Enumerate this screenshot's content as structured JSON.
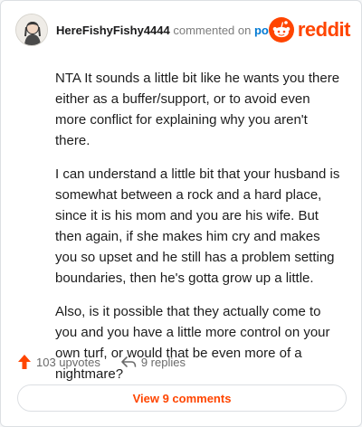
{
  "comment": {
    "author": "HereFishyFishy4444",
    "action_text": "commented on",
    "post_link": "post",
    "paragraphs": [
      "NTA It sounds a little bit like he wants you there either as a buffer/support, or to avoid even more conflict for explaining why you aren't there.",
      "I can understand a little bit that your husband is somewhat between a rock and a hard place, since it is his mom and you are his wife. But then again, if she makes him cry and makes you so upset and he still has a problem setting boundaries, then he's gotta grow up a little.",
      "Also, is it possible that they actually come to you and you have a little more control on your own turf, or would that be even more of a nightmare?"
    ]
  },
  "brand": {
    "name": "reddit",
    "icon": "reddit-alien-icon",
    "color": "#ff4500"
  },
  "actions": {
    "upvotes": "103 upvotes",
    "replies": "9 replies",
    "upvote_icon": "upvote-arrow-icon",
    "reply_icon": "reply-arrow-icon",
    "upvote_color": "#ff4500"
  },
  "footer": {
    "view_comments": "View 9 comments"
  }
}
